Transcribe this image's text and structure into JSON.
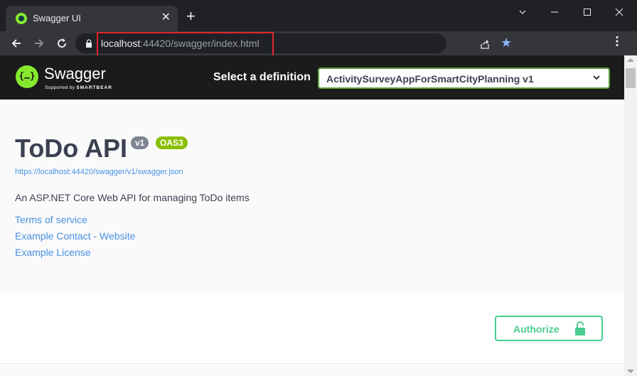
{
  "browser": {
    "tab_title": "Swagger UI",
    "tab_close": "✕",
    "new_tab": "+",
    "url_host": "localhost",
    "url_rest": ":44420/swagger/index.html"
  },
  "swagger_header": {
    "logo_text": "Swagger",
    "logo_sub_prefix": "Supported by",
    "logo_sub_brand": "SMARTBEAR",
    "definition_label": "Select a definition",
    "definition_value": "ActivitySurveyAppForSmartCityPlanning v1"
  },
  "info": {
    "title": "ToDo API",
    "version_badge": "v1",
    "oas_badge": "OAS3",
    "spec_url": "https://localhost:44420/swagger/v1/swagger.json",
    "description": "An ASP.NET Core Web API for managing ToDo items",
    "links": {
      "terms": "Terms of service",
      "contact": "Example Contact - Website",
      "license": "Example License"
    }
  },
  "scheme": {
    "authorize_label": "Authorize"
  },
  "colors": {
    "swagger_green": "#85ea2d",
    "header_bg": "#1b1b1b",
    "link_blue": "#4990e2",
    "authorize_green": "#49cc90",
    "highlight_red": "#e0262e"
  }
}
